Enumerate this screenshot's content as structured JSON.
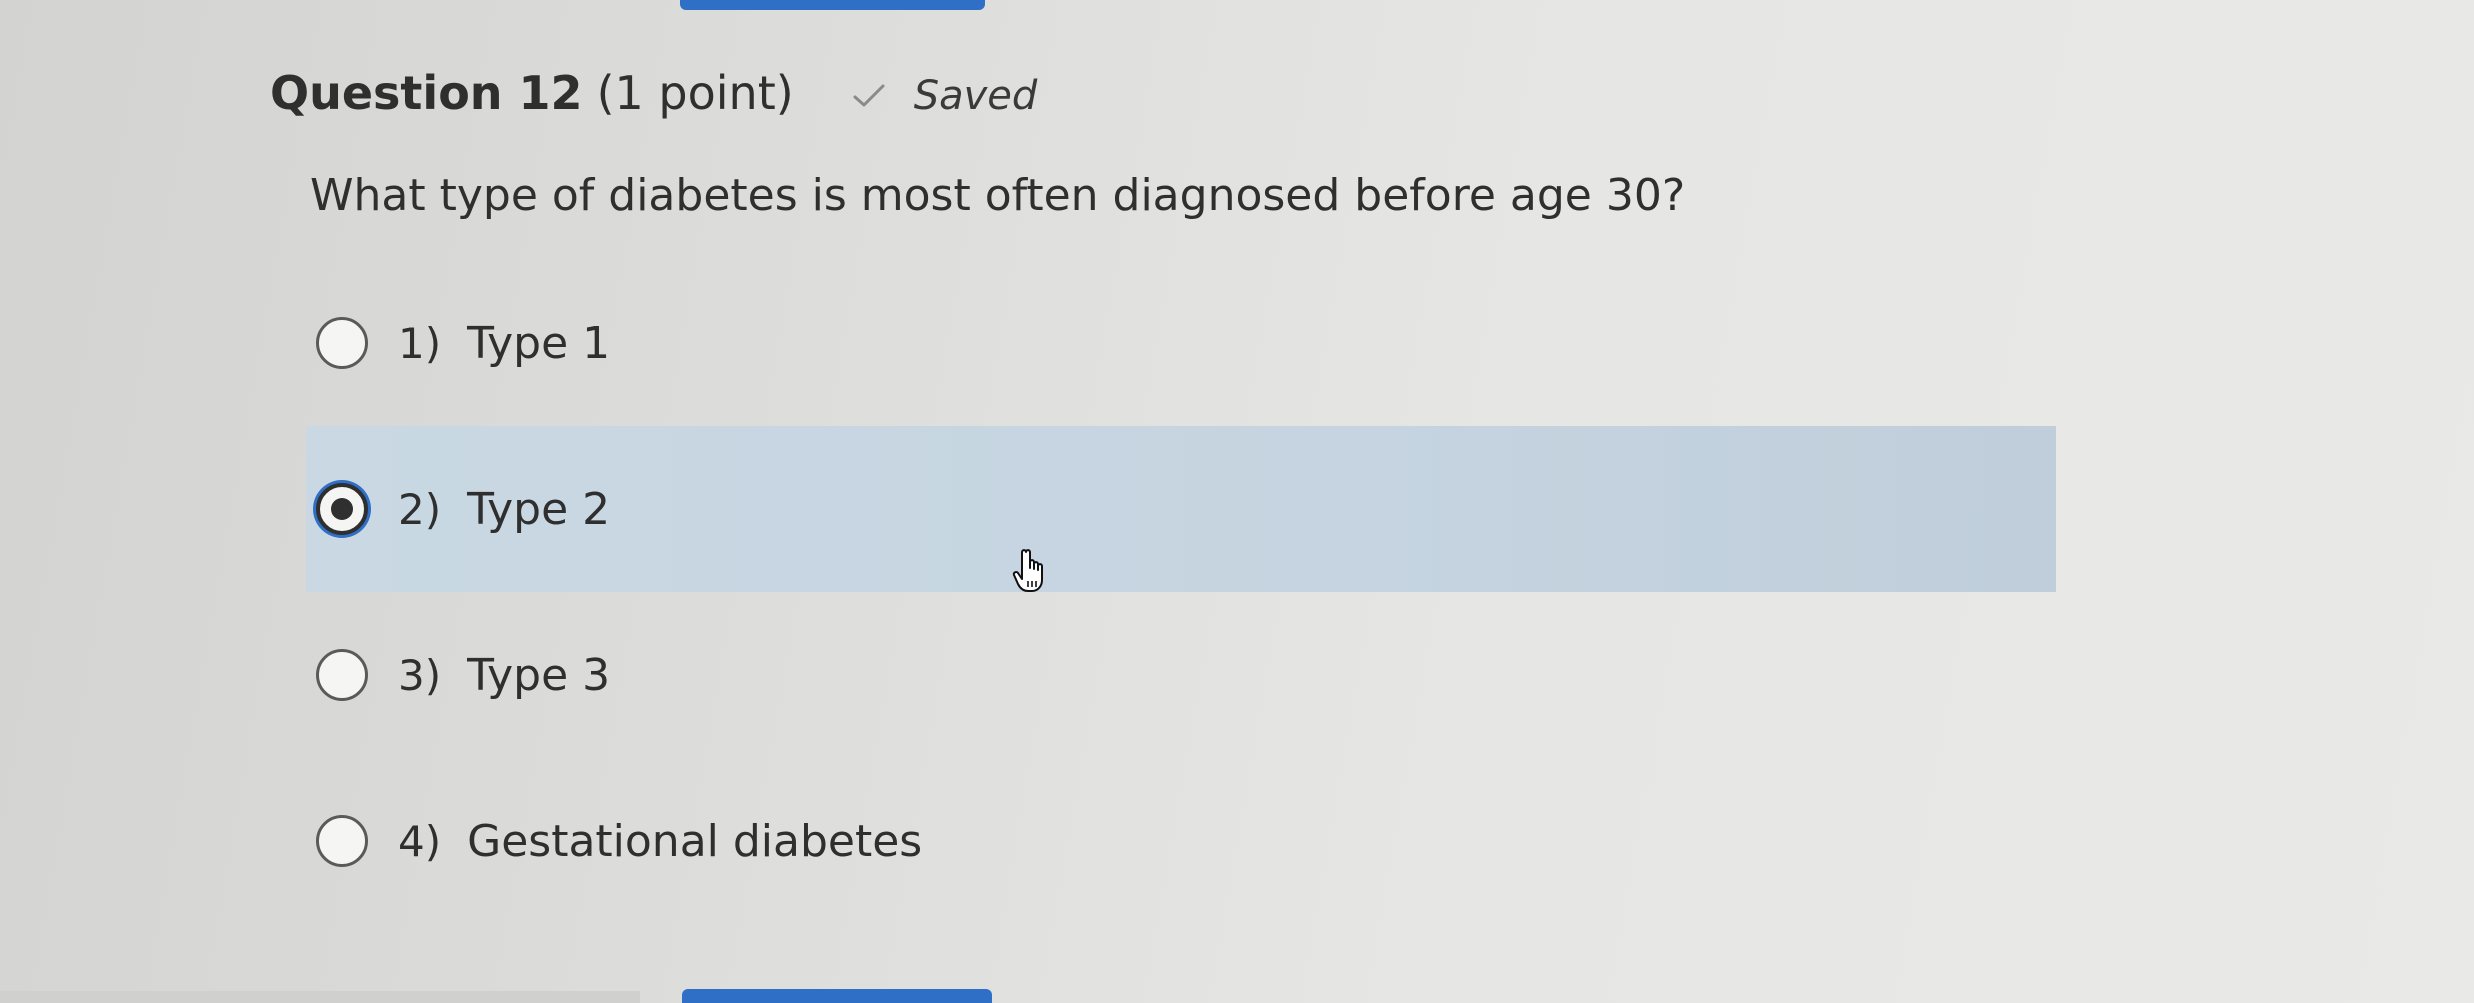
{
  "question": {
    "title": "Question 12",
    "points": "(1 point)",
    "status": "Saved",
    "status_icon": "checkmark-icon",
    "text": "What type of diabetes is most often diagnosed before age 30?"
  },
  "options": [
    {
      "number": "1)",
      "label": "Type 1",
      "selected": false
    },
    {
      "number": "2)",
      "label": "Type 2",
      "selected": true
    },
    {
      "number": "3)",
      "label": "Type 3",
      "selected": false
    },
    {
      "number": "4)",
      "label": "Gestational diabetes",
      "selected": false
    }
  ],
  "colors": {
    "accent": "#2f6fc6",
    "selected_row": "#c5d4e0",
    "text": "#2f2f2f"
  }
}
